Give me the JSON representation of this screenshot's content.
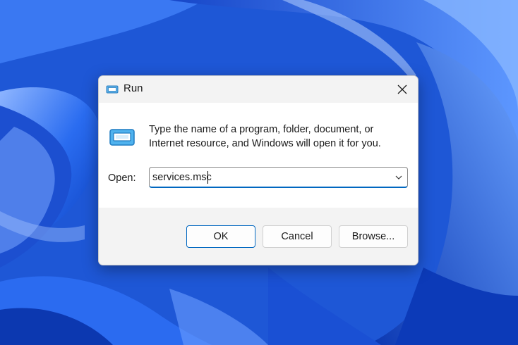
{
  "colors": {
    "wallpaper_base": "#1f58d8",
    "accent": "#0067c0",
    "dialog_bg": "#f3f3f3",
    "content_bg": "#ffffff"
  },
  "dialog": {
    "title": "Run",
    "title_icon": "run-icon",
    "close_icon": "close-icon",
    "description": "Type the name of a program, folder, document, or Internet resource, and Windows will open it for you.",
    "open_label": "Open:",
    "input_value": "services.msc",
    "dropdown_icon": "chevron-down-icon",
    "buttons": {
      "ok": "OK",
      "cancel": "Cancel",
      "browse": "Browse..."
    }
  }
}
